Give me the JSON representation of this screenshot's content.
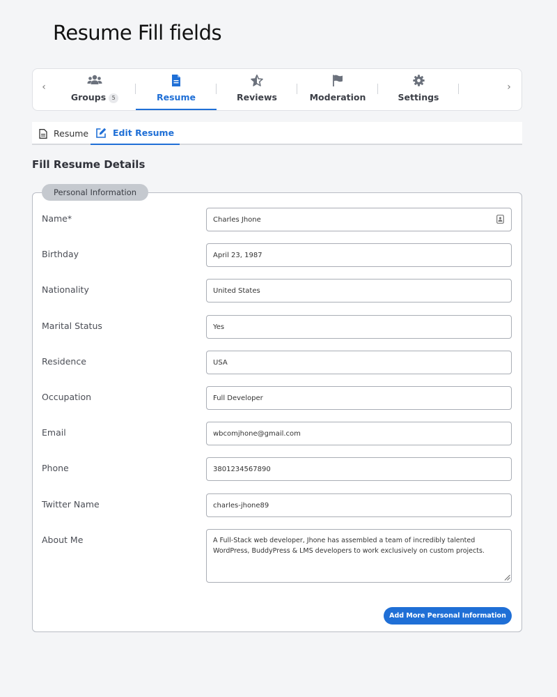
{
  "page": {
    "title": "Resume Fill fields"
  },
  "tabs": {
    "prev_icon": "chevron-left-icon",
    "next_icon": "chevron-right-icon",
    "items": [
      {
        "label": "Groups",
        "icon": "users-icon",
        "badge": "5",
        "active": false
      },
      {
        "label": "Resume",
        "icon": "document-icon",
        "active": true
      },
      {
        "label": "Reviews",
        "icon": "star-icon",
        "active": false
      },
      {
        "label": "Moderation",
        "icon": "flag-icon",
        "active": false
      },
      {
        "label": "Settings",
        "icon": "gear-icon",
        "active": false
      }
    ]
  },
  "subnav": {
    "items": [
      {
        "label": "Resume",
        "icon": "document-icon",
        "active": false
      },
      {
        "label": "Edit Resume",
        "icon": "edit-icon",
        "active": true
      }
    ]
  },
  "form": {
    "heading": "Fill Resume Details",
    "section_label": "Personal Information",
    "fields": {
      "name": {
        "label": "Name*",
        "value": "Charles Jhone"
      },
      "birthday": {
        "label": "Birthday",
        "value": "April 23, 1987"
      },
      "nationality": {
        "label": "Nationality",
        "value": "United States"
      },
      "marital_status": {
        "label": "Marital Status",
        "value": "Yes"
      },
      "residence": {
        "label": "Residence",
        "value": "USA"
      },
      "occupation": {
        "label": "Occupation",
        "value": "Full Developer"
      },
      "email": {
        "label": "Email",
        "value": "wbcomjhone@gmail.com"
      },
      "phone": {
        "label": "Phone",
        "value": "3801234567890"
      },
      "twitter": {
        "label": "Twitter Name",
        "value": "charles-jhone89"
      },
      "about": {
        "label": "About Me",
        "value": "A Full-Stack web developer, Jhone has assembled a team of incredibly talented WordPress, BuddyPress & LMS developers to work exclusively on custom projects."
      }
    },
    "add_button_label": "Add More Personal Information"
  },
  "colors": {
    "accent": "#1f6fd6",
    "legend_bg": "#c5c9cf",
    "tab_icon": "#6b717c"
  }
}
